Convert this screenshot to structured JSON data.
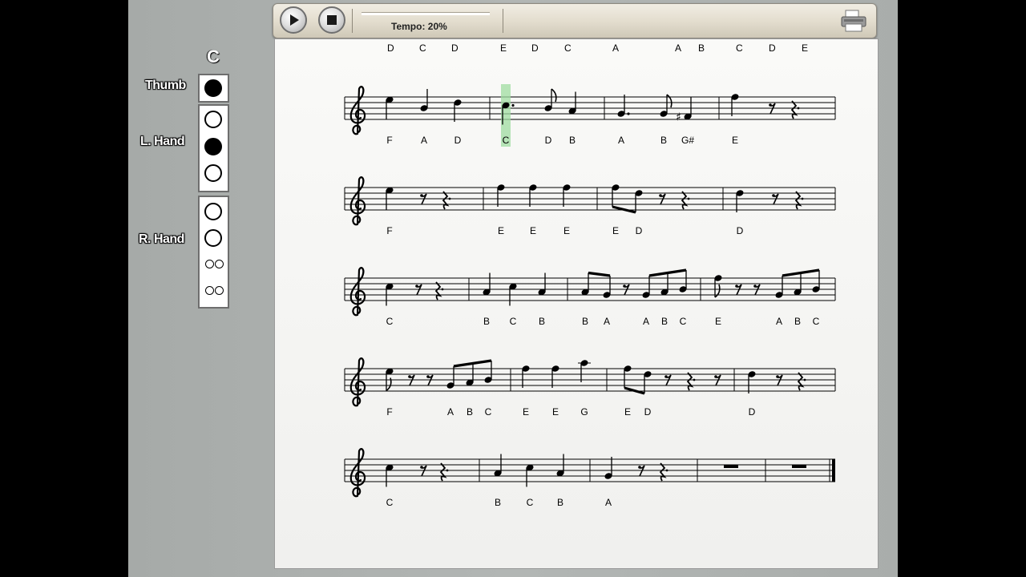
{
  "toolbar": {
    "tempo_label": "Tempo: 20%",
    "tempo_value": 0.2,
    "play_icon": "play-icon",
    "stop_icon": "stop-icon",
    "print_icon": "printer-icon"
  },
  "fingering": {
    "note": "C",
    "labels": {
      "thumb": "Thumb",
      "left": "L. Hand",
      "right": "R. Hand"
    },
    "thumb": [
      true
    ],
    "left_hand": [
      false,
      true,
      false
    ],
    "right_hand": [
      false,
      false,
      "double-open",
      "double-open"
    ]
  },
  "top_notes": [
    "D",
    "C",
    "D",
    "E",
    "D",
    "C",
    "A",
    "A",
    "B",
    "C",
    "D",
    "E"
  ],
  "rows": [
    {
      "measures": 4,
      "names": [
        "F",
        "A",
        "D",
        "C",
        "D",
        "B",
        "A",
        "B",
        "G#",
        "E"
      ],
      "highlight_index": 3
    },
    {
      "measures": 4,
      "names": [
        "F",
        "E",
        "E",
        "E",
        "E",
        "D",
        "D"
      ]
    },
    {
      "measures": 4,
      "names": [
        "C",
        "B",
        "C",
        "B",
        "B",
        "A",
        "A",
        "B",
        "C",
        "E",
        "A",
        "B",
        "C"
      ]
    },
    {
      "measures": 4,
      "names": [
        "F",
        "A",
        "B",
        "C",
        "E",
        "E",
        "G",
        "E",
        "D",
        "D"
      ]
    },
    {
      "measures": 5,
      "names": [
        "C",
        "B",
        "C",
        "B",
        "A"
      ]
    }
  ],
  "colors": {
    "highlight": "#9fdca0",
    "sheet": "#f6f6f4"
  }
}
